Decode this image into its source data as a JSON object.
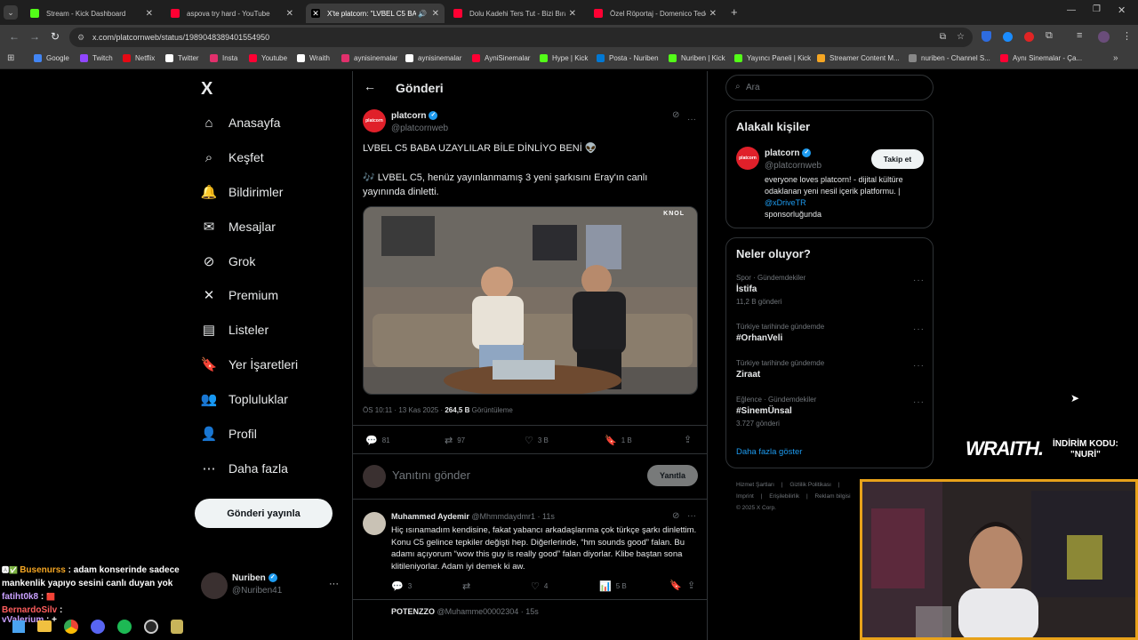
{
  "browser": {
    "tabs": [
      {
        "title": "Stream - Kick Dashboard",
        "color": "#53fc18"
      },
      {
        "title": "aspova try hard - YouTube",
        "color": "#ff0033"
      },
      {
        "title": "X'te platcorn: \"LVBEL C5 BA...",
        "color": "#ffffff"
      },
      {
        "title": "Dolu Kadehi Ters Tut - Bizi Bıraktı...",
        "color": "#ff0033"
      },
      {
        "title": "Özel Röportaj - Domenico Tede...",
        "color": "#ff0033"
      }
    ],
    "url": "x.com/platcornweb/status/1989048389401554950",
    "bookmarks": [
      {
        "label": "Google",
        "color": "#4285f4"
      },
      {
        "label": "Twitch",
        "color": "#9146ff"
      },
      {
        "label": "Netflix",
        "color": "#e50914"
      },
      {
        "label": "Twitter",
        "color": "#ffffff"
      },
      {
        "label": "Insta",
        "color": "#e1306c"
      },
      {
        "label": "Youtube",
        "color": "#ff0033"
      },
      {
        "label": "Wraith",
        "color": "#ffffff"
      },
      {
        "label": "aynisinemalar",
        "color": "#e1306c"
      },
      {
        "label": "aynisinemalar",
        "color": "#ffffff"
      },
      {
        "label": "AyniSinemalar",
        "color": "#ff0033"
      },
      {
        "label": "Hype | Kick",
        "color": "#53fc18"
      },
      {
        "label": "Posta - Nuriben",
        "color": "#0078d4"
      },
      {
        "label": "Nuriben | Kick",
        "color": "#53fc18"
      },
      {
        "label": "Yayıncı Paneli | Kick",
        "color": "#53fc18"
      },
      {
        "label": "Streamer Content M...",
        "color": "#f5a623"
      },
      {
        "label": "nuriben - Channel S...",
        "color": "#888888"
      },
      {
        "label": "Aynı Sinemalar - Ça...",
        "color": "#ff0033"
      }
    ]
  },
  "sidebar": {
    "logo": "X",
    "items": [
      {
        "label": "Anasayfa",
        "icon": "home-icon",
        "glyph": "⌂"
      },
      {
        "label": "Keşfet",
        "icon": "search-icon",
        "glyph": "⌕"
      },
      {
        "label": "Bildirimler",
        "icon": "bell-icon",
        "glyph": "🔔"
      },
      {
        "label": "Mesajlar",
        "icon": "mail-icon",
        "glyph": "✉"
      },
      {
        "label": "Grok",
        "icon": "grok-icon",
        "glyph": "⊘"
      },
      {
        "label": "Premium",
        "icon": "x-logo-icon",
        "glyph": "✕"
      },
      {
        "label": "Listeler",
        "icon": "list-icon",
        "glyph": "▤"
      },
      {
        "label": "Yer İşaretleri",
        "icon": "bookmark-icon",
        "glyph": "🔖"
      },
      {
        "label": "Topluluklar",
        "icon": "people-icon",
        "glyph": "👥"
      },
      {
        "label": "Profil",
        "icon": "person-icon",
        "glyph": "👤"
      },
      {
        "label": "Daha fazla",
        "icon": "more-circle-icon",
        "glyph": "⋯"
      }
    ],
    "post_button": "Gönderi yayınla",
    "account": {
      "name": "Nuriben",
      "handle": "@Nuriben41"
    }
  },
  "header": {
    "title": "Gönderi"
  },
  "tweet": {
    "author": "platcorn",
    "handle": "@platcornweb",
    "line1": "LVBEL C5 BABA UZAYLILAR BİLE DİNLİYO BENİ 👽",
    "line2": "🎶 LVBEL C5, henüz yayınlanmamış 3 yeni şarkısını Eray'ın canlı yayınında dinletti.",
    "media_watermark": "KNOL",
    "time": "ÖS 10:11 · 13 Kas 2025 · ",
    "views": "264,5 B",
    "views_label": " Görüntüleme",
    "stats": {
      "replies": "81",
      "reposts": "97",
      "likes": "3 B",
      "bookmarks": "1 B"
    }
  },
  "reply_box": {
    "placeholder": "Yanıtını gönder",
    "button": "Yanıtla"
  },
  "replies": [
    {
      "name": "Muhammed Aydemir",
      "handle": "@Mhmmdaydmr1 · 11s",
      "text": "Hiç ısınamadım kendisine, fakat yabancı arkadaşlarıma çok türkçe şarkı dinlettim. Konu C5 gelince tepkiler değişti hep. Diğerlerinde, “hm sounds good” falan. Bu adamı açıyorum “wow this guy is really good” falan diyorlar. Klibe baştan sona klitileniyorlar. Adam iyi demek ki aw.",
      "stats": {
        "replies": "3",
        "reposts": "",
        "likes": "4",
        "views": "5 B"
      }
    },
    {
      "name": "POTENZZO",
      "handle": "@Muhamme00002304 · 15s"
    }
  ],
  "search": {
    "placeholder": "Ara"
  },
  "related": {
    "title": "Alakalı kişiler",
    "name": "platcorn",
    "handle": "@platcornweb",
    "follow": "Takip et",
    "bio": "everyone loves platcorn! - dijital kültüre odaklanan yeni nesil içerik platformu. | ",
    "bio_link": "@xDriveTR",
    "bio_end": "sponsorluğunda"
  },
  "trends": {
    "title": "Neler oluyor?",
    "items": [
      {
        "meta": "Spor · Gündemdekiler",
        "name": "İstifa",
        "count": "11,2 B gönderi"
      },
      {
        "meta": "Türkiye tarihinde gündemde",
        "name": "#OrhanVeli",
        "count": ""
      },
      {
        "meta": "Türkiye tarihinde gündemde",
        "name": "Ziraat",
        "count": ""
      },
      {
        "meta": "Eğlence · Gündemdekiler",
        "name": "#SinemÜnsal",
        "count": "3.727 gönderi"
      }
    ],
    "show_more": "Daha fazla göster"
  },
  "footer": {
    "links": [
      "Hizmet Şartları",
      "Gizlilik Politikası",
      "Imprint",
      "Erişilebilirlik",
      "Reklam bilgisi"
    ],
    "copyright": "© 2025 X Corp."
  },
  "overlay": {
    "sponsor": "WRAITH.",
    "code_label": "İNDİRİM KODU:",
    "code": "\"NURİ\"",
    "chat": [
      {
        "user": "Busenurss",
        "text": " : adam konserinde sadece mankenlik yapıyo sesini canlı duyan yok",
        "color": "#f5a623"
      },
      {
        "user": "fatiht0k8",
        "text": " : ",
        "color": "#c9a0ff"
      },
      {
        "user": "BernardoSilv",
        "text": " : ",
        "color": "#ff5e5e"
      },
      {
        "user": "vValerium",
        "text": " : +",
        "color": "#c9a0ff"
      }
    ]
  }
}
